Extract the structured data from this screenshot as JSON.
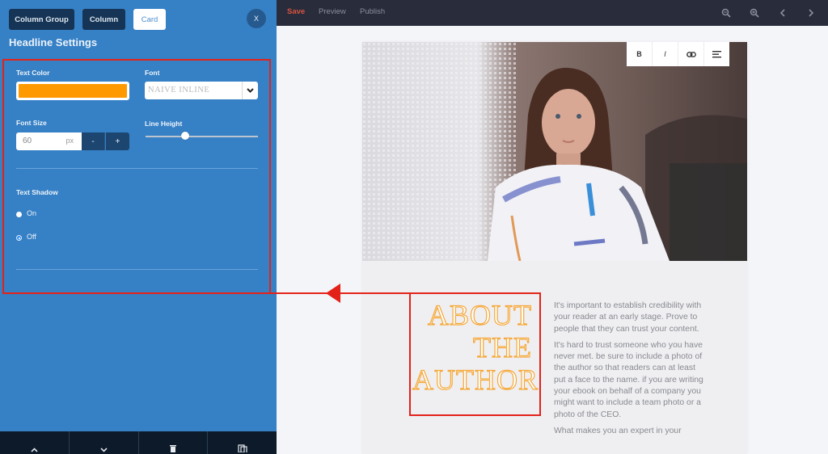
{
  "sidebar": {
    "tabs": [
      {
        "label": "Column Group",
        "active": false
      },
      {
        "label": "Column",
        "active": false
      },
      {
        "label": "Card",
        "active": true
      }
    ],
    "close_label": "X",
    "title": "Headline Settings",
    "text_color": {
      "label": "Text Color",
      "value": "#ff9900"
    },
    "font": {
      "label": "Font",
      "value": "NAIVE INLINE"
    },
    "font_size": {
      "label": "Font Size",
      "value": "60",
      "unit": "px",
      "decrement_label": "-",
      "increment_label": "+"
    },
    "line_height": {
      "label": "Line Height",
      "value_fraction": 0.35
    },
    "text_shadow": {
      "label": "Text Shadow",
      "options": [
        {
          "label": "On",
          "selected": false
        },
        {
          "label": "Off",
          "selected": true
        }
      ]
    },
    "bottom_actions": [
      {
        "icon": "chevron-up-icon"
      },
      {
        "icon": "chevron-down-icon"
      },
      {
        "icon": "trash-icon"
      },
      {
        "icon": "duplicate-icon"
      }
    ]
  },
  "topbar": {
    "save_label": "Save",
    "preview_label": "Preview",
    "publish_label": "Publish",
    "save_color": "#d9533f",
    "icons": [
      "zoom-out-icon",
      "zoom-in-icon",
      "chevron-left-icon",
      "chevron-right-icon"
    ]
  },
  "format_toolbar": {
    "bold_label": "B",
    "italic_label": "I",
    "link_icon": "link-icon",
    "align_icon": "align-left-icon"
  },
  "card": {
    "headline_lines": [
      "ABOUT",
      "THE",
      "AUTHOR"
    ],
    "headline_color": "#ff9900",
    "paragraphs": [
      "It's important to establish credibility with your reader at an early stage. Prove to people that they can trust your content.",
      "It's hard to trust someone who you have never met. be sure to include a photo of the author so that readers can at least put a face to the name. if you are writing your ebook on behalf of a company you might want to include a team photo or a photo of the CEO.",
      "What makes you an expert in your"
    ]
  },
  "annotation": {
    "color": "#e3231a"
  }
}
